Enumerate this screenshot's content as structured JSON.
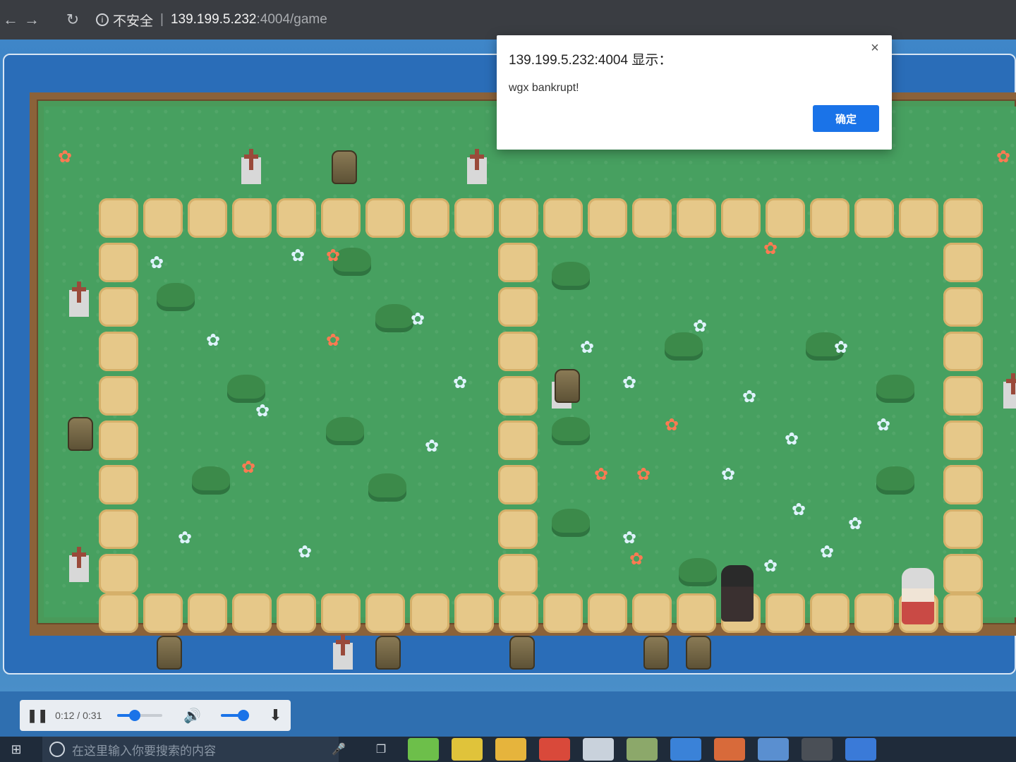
{
  "browser": {
    "back_glyph": "←",
    "forward_glyph": "→",
    "reload_glyph": "↻",
    "info_glyph": "i",
    "insecure_label": "不安全",
    "separator": "|",
    "url_host": "139.199.5.232",
    "url_path": ":4004/game"
  },
  "alert": {
    "title": "139.199.5.232:4004 显示：",
    "message": "wgx bankrupt!",
    "ok_label": "确定",
    "close_glyph": "×"
  },
  "media": {
    "pause_glyph": "❚❚",
    "time": "0:12 / 0:31",
    "progress_fraction": 0.39,
    "volume_fraction": 0.8,
    "volume_glyph": "🔊",
    "download_glyph": "⬇"
  },
  "taskbar": {
    "start_glyph": "⊞",
    "search_placeholder": "在这里输入你要搜索的内容",
    "mic_glyph": "🎤",
    "taskview_glyph": "❐",
    "apps": [
      {
        "name": "wechat",
        "color": "#6dbf4a"
      },
      {
        "name": "chrome",
        "color": "#e0c33a"
      },
      {
        "name": "explorer",
        "color": "#e6b43c"
      },
      {
        "name": "youdao",
        "color": "#d9493a"
      },
      {
        "name": "app-round",
        "color": "#c9d2dc"
      },
      {
        "name": "app-pen",
        "color": "#8ca86a"
      },
      {
        "name": "word-like",
        "color": "#3a82d8"
      },
      {
        "name": "powerpoint-like",
        "color": "#d86a3a"
      },
      {
        "name": "app-blue",
        "color": "#5a8fd0"
      },
      {
        "name": "terminal",
        "color": "#4a4f56"
      },
      {
        "name": "app-ring",
        "color": "#3a7ad8"
      }
    ]
  },
  "colors": {
    "grass": "#47a060",
    "path_tile": "#e6c889",
    "dialog_button": "#1a73e8",
    "border_wood": "#8b6239"
  }
}
